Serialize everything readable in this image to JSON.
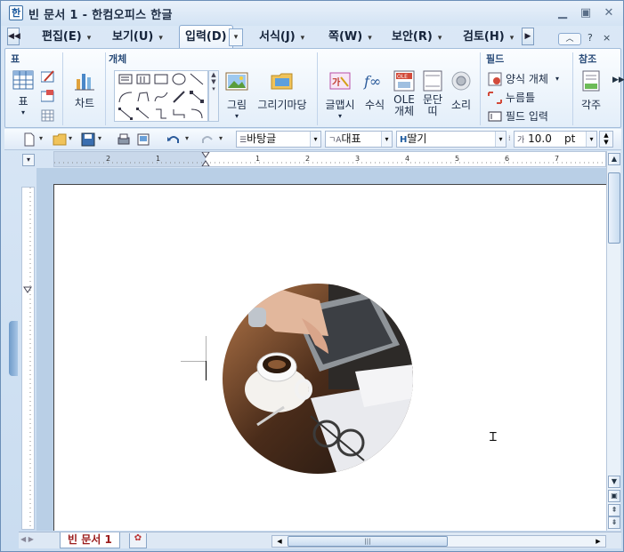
{
  "window": {
    "title": "빈 문서 1 - 한컴오피스 한글",
    "app_icon": "한"
  },
  "menu": {
    "tabs": [
      {
        "label": "편집(E)"
      },
      {
        "label": "보기(U)"
      },
      {
        "label": "입력(D)",
        "active": true
      },
      {
        "label": "서식(J)"
      },
      {
        "label": "쪽(W)"
      },
      {
        "label": "보안(R)"
      },
      {
        "label": "검토(H)"
      }
    ],
    "help": "?",
    "close": "×"
  },
  "ribbon": {
    "groups": {
      "table": "표",
      "objects": "개체",
      "fields": "필드",
      "reference": "참조"
    },
    "buttons": {
      "table": "표",
      "chart": "차트",
      "picture": "그림",
      "draw_wizard": "그리기마당",
      "wordart": "글맵시",
      "equation": "수식",
      "ole_line1": "OLE",
      "ole_line2": "개체",
      "paragraph_line1": "문단",
      "paragraph_line2": "띠",
      "sound": "소리",
      "form_object": "양식 개체",
      "click_here": "누름틀",
      "field_input": "필드 입력",
      "annotation": "각주"
    }
  },
  "toolbar": {
    "style": "바탕글",
    "language": "대표",
    "font": "딸기",
    "font_size": "10.0",
    "size_unit": "pt"
  },
  "ruler": {
    "marks": [
      "2",
      "1",
      "1",
      "2",
      "3",
      "4",
      "5",
      "6",
      "7"
    ]
  },
  "document": {
    "tab_label": "빈 문서 1"
  },
  "colors": {
    "accent": "#2a4c79",
    "doc_tab_text": "#9b1c1c",
    "workspace": "#b9cfe6"
  }
}
